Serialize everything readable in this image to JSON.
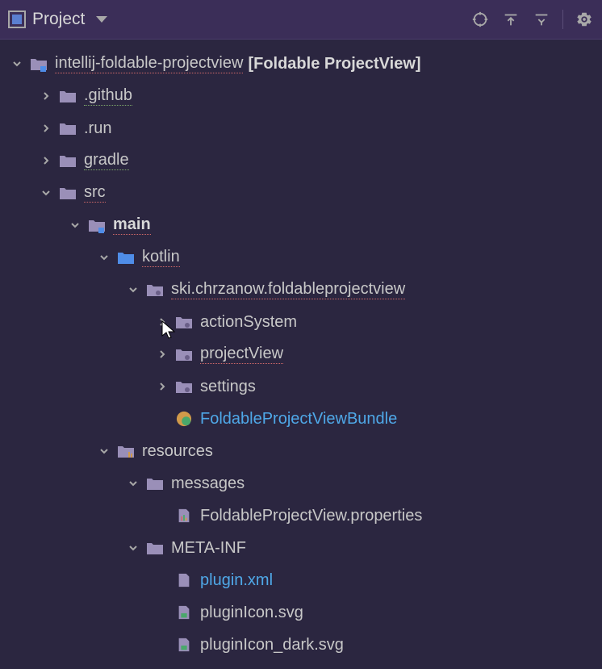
{
  "toolbar": {
    "title": "Project"
  },
  "tree": {
    "root": {
      "name": "intellij-foldable-projectview",
      "extra": "[Foldable ProjectView]"
    },
    "nodes": {
      "github": ".github",
      "run": ".run",
      "gradle": "gradle",
      "src": "src",
      "main": "main",
      "kotlin": "kotlin",
      "pkg": "ski.chrzanow.foldableprojectview",
      "actionSystem": "actionSystem",
      "projectView": "projectView",
      "settings": "settings",
      "bundle": "FoldableProjectViewBundle",
      "resources": "resources",
      "messages": "messages",
      "propsFile": "FoldableProjectView.properties",
      "metainf": "META-INF",
      "pluginXml": "plugin.xml",
      "pluginIcon": "pluginIcon.svg",
      "pluginIconDark": "pluginIcon_dark.svg"
    }
  }
}
